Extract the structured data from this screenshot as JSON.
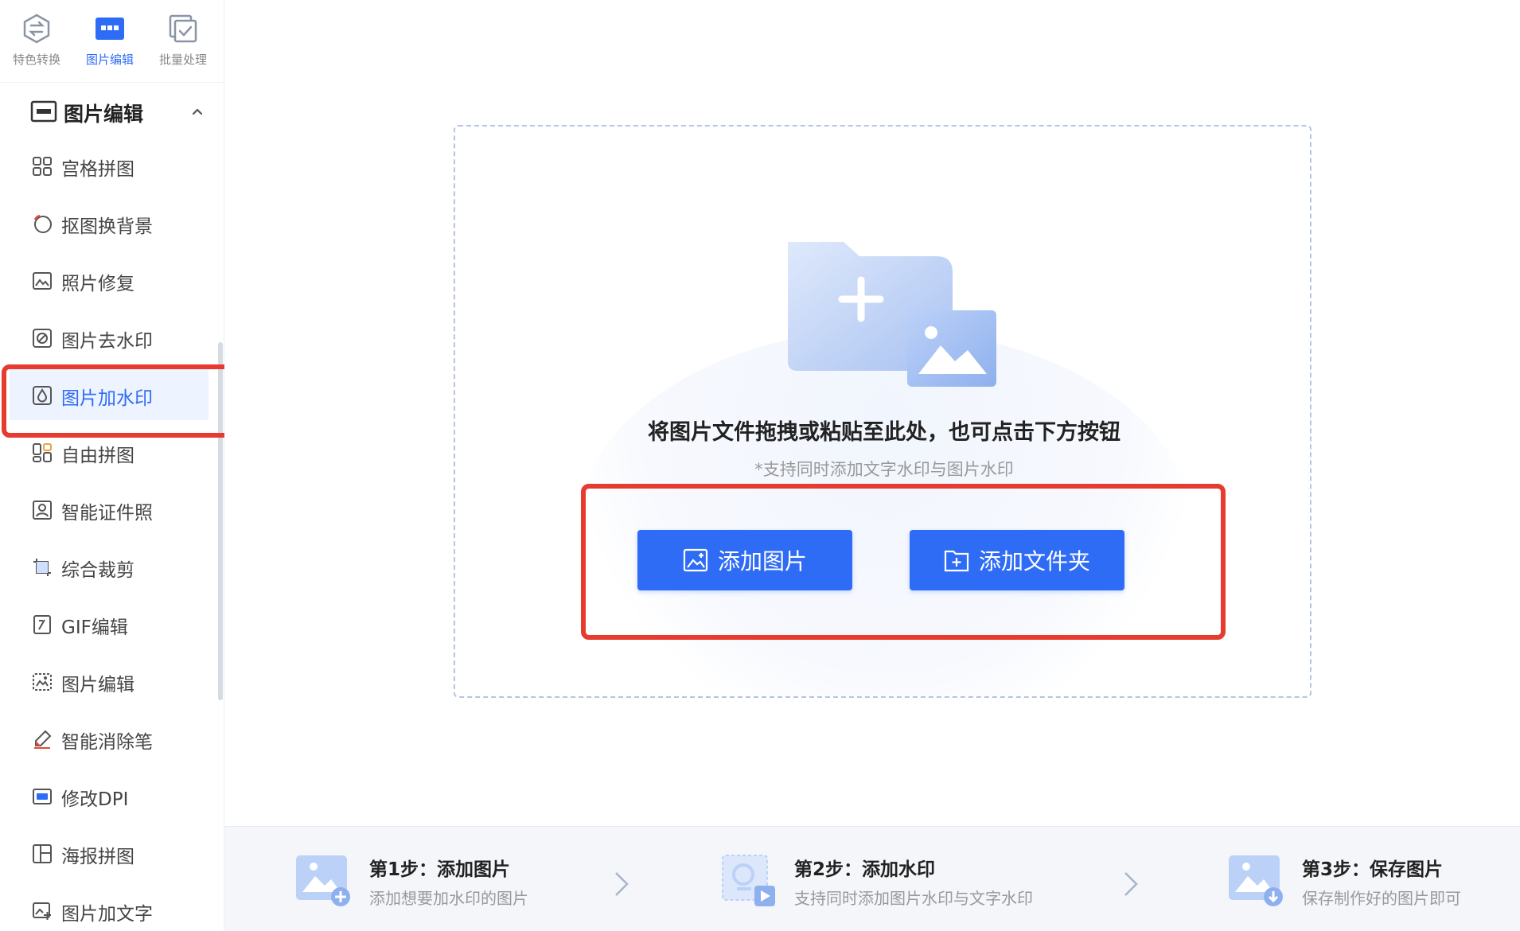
{
  "colors": {
    "accent": "#2f6cf6",
    "highlight_box": "#e63b2e",
    "active_bg": "#edf3ff"
  },
  "top_tabs": [
    {
      "label": "特色转换",
      "icon": "convert-icon",
      "active": false
    },
    {
      "label": "图片编辑",
      "icon": "image-edit-icon",
      "active": true
    },
    {
      "label": "批量处理",
      "icon": "batch-icon",
      "active": false
    }
  ],
  "section": {
    "label": "图片编辑",
    "icon": "image-edit-icon",
    "expanded": true
  },
  "menu": [
    {
      "label": "宫格拼图",
      "icon": "grid-icon"
    },
    {
      "label": "抠图换背景",
      "icon": "cutout-icon"
    },
    {
      "label": "照片修复",
      "icon": "photo-repair-icon"
    },
    {
      "label": "图片去水印",
      "icon": "remove-watermark-icon"
    },
    {
      "label": "图片加水印",
      "icon": "add-watermark-icon",
      "active": true
    },
    {
      "label": "自由拼图",
      "icon": "free-collage-icon"
    },
    {
      "label": "智能证件照",
      "icon": "id-photo-icon"
    },
    {
      "label": "综合裁剪",
      "icon": "crop-icon"
    },
    {
      "label": "GIF编辑",
      "icon": "gif-icon"
    },
    {
      "label": "图片编辑",
      "icon": "picture-edit-icon"
    },
    {
      "label": "智能消除笔",
      "icon": "eraser-pen-icon"
    },
    {
      "label": "修改DPI",
      "icon": "dpi-icon"
    },
    {
      "label": "海报拼图",
      "icon": "poster-icon"
    },
    {
      "label": "图片加文字",
      "icon": "add-text-icon"
    }
  ],
  "drop_zone": {
    "title": "将图片文件拖拽或粘贴至此处，也可点击下方按钮",
    "subtitle": "*支持同时添加文字水印与图片水印",
    "add_image_label": "添加图片",
    "add_folder_label": "添加文件夹"
  },
  "steps": [
    {
      "title": "第1步：添加图片",
      "desc": "添加想要加水印的图片",
      "icon": "add-image-step-icon"
    },
    {
      "title": "第2步：添加水印",
      "desc": "支持同时添加图片水印与文字水印",
      "icon": "add-watermark-step-icon"
    },
    {
      "title": "第3步：保存图片",
      "desc": "保存制作好的图片即可",
      "icon": "save-image-step-icon"
    }
  ]
}
